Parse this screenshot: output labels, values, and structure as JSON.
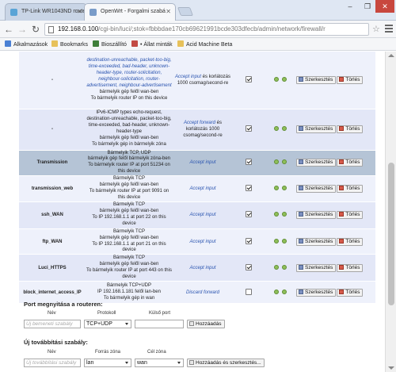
{
  "browser": {
    "tabs": [
      {
        "title": "TP-Link WR1043ND route"
      },
      {
        "title": "OpenWrt - Forgalmi szabá"
      }
    ],
    "window_controls": {
      "min": "–",
      "max": "❐",
      "close": "✕"
    },
    "url_host": "192.168.0.100",
    "url_path": "/cgi-bin/luci/;stok=fbbbdae170cb69621991bcde303dfecb/admin/network/firewall/r",
    "bookmarks": [
      "Alkalmazások",
      "Bookmarks",
      "Bioszállító",
      "• Állat minták",
      "Acid Machine Beta"
    ]
  },
  "rules": [
    {
      "name": "-",
      "match": [
        {
          "t": "destination-unreachable, packet-too-big, time-exceeded, bad-header, unknown-header-type, router-solicitation, neighbour-solicitation, router-advertisement, neighbour-advertisement",
          "blue": true
        },
        {
          "t": "bármelyik gép felől wan-ben",
          "blue": false
        },
        {
          "t": "To bármelyik router IP on this device",
          "blue": false
        }
      ],
      "action": [
        {
          "t": "Accept input",
          "blue": true
        },
        {
          "t": " és korlátozás 1000 csomag/second-re",
          "blue": false
        }
      ],
      "enabled": true,
      "row": "odd"
    },
    {
      "name": "-",
      "match": [
        {
          "t": "IPv6-ICMP types echo-request, destination-unreachable, packet-too-big, time-exceeded, bad-header, unknown-header-type",
          "blue": false
        },
        {
          "t": "bármelyik gép felől wan-ben",
          "blue": false
        },
        {
          "t": "To bármelyik gép in bármelyik zóna",
          "blue": false
        }
      ],
      "action": [
        {
          "t": "Accept forward",
          "blue": true
        },
        {
          "t": " és korlátozás 1000 csomag/second-re",
          "blue": false
        }
      ],
      "enabled": true,
      "row": "even"
    },
    {
      "name": "Transmission",
      "match": [
        {
          "t": "Bármelyik TCP, UDP",
          "blue": false
        },
        {
          "t": "bármelyik gép felől bármelyik zóna-ben",
          "blue": false
        },
        {
          "t": "To bármelyik router IP at port 51234 on this device",
          "blue": false
        }
      ],
      "action": [
        {
          "t": "Accept input",
          "blue": true
        }
      ],
      "enabled": true,
      "row": "hl"
    },
    {
      "name": "transmission_web",
      "match": [
        {
          "t": "Bármelyik TCP",
          "blue": false
        },
        {
          "t": "bármelyik gép felől wan-ben",
          "blue": false
        },
        {
          "t": "To bármelyik router IP at port 9091 on this device",
          "blue": false
        }
      ],
      "action": [
        {
          "t": "Accept input",
          "blue": true
        }
      ],
      "enabled": true,
      "row": "odd"
    },
    {
      "name": "ssh_WAN",
      "match": [
        {
          "t": "Bármelyik TCP",
          "blue": false
        },
        {
          "t": "bármelyik gép felől wan-ben",
          "blue": false
        },
        {
          "t": "To IP 192.168.1.1 at port 22 on this device",
          "blue": false
        }
      ],
      "action": [
        {
          "t": "Accept input",
          "blue": true
        }
      ],
      "enabled": true,
      "row": "even"
    },
    {
      "name": "ftp_WAN",
      "match": [
        {
          "t": "Bármelyik TCP",
          "blue": false
        },
        {
          "t": "bármelyik gép felől wan-ben",
          "blue": false
        },
        {
          "t": "To IP 192.168.1.1 at port 21 on this device",
          "blue": false
        }
      ],
      "action": [
        {
          "t": "Accept input",
          "blue": true
        }
      ],
      "enabled": true,
      "row": "odd"
    },
    {
      "name": "Luci_HTTPS",
      "match": [
        {
          "t": "Bármelyik TCP",
          "blue": false
        },
        {
          "t": "bármelyik gép felől wan-ben",
          "blue": false
        },
        {
          "t": "To bármelyik router IP at port 443 on this device",
          "blue": false
        }
      ],
      "action": [
        {
          "t": "Accept input",
          "blue": true
        }
      ],
      "enabled": true,
      "row": "even"
    },
    {
      "name": "block_internet_access_IP",
      "match": [
        {
          "t": "Bármelyik TCP+UDP",
          "blue": false
        },
        {
          "t": "IP 192.168.1.181 felől lan-ben",
          "blue": false
        },
        {
          "t": "To bármelyik gép in wan",
          "blue": false
        }
      ],
      "action": [
        {
          "t": "Discard forward",
          "blue": true
        }
      ],
      "enabled": false,
      "row": "odd"
    }
  ],
  "buttons": {
    "edit": "Szerkesztés",
    "delete": "Törlés"
  },
  "port_open": {
    "title": "Port megnyitása a routeren:",
    "col_name": "Név",
    "col_protocol": "Protokoll",
    "col_port": "Külső port",
    "name_placeholder": "Új bemeneti szabály",
    "protocol": "TCP+UDP",
    "port_value": "",
    "add": "Hozzáadás"
  },
  "forward": {
    "title": "Új továbbítási szabály:",
    "col_name": "Név",
    "col_src": "Forrás zóna",
    "col_dst": "Cél zóna",
    "name_placeholder": "Új továbbítási szabály",
    "src": "lan",
    "dst": "wan",
    "add": "Hozzáadás és szerkesztés..."
  }
}
